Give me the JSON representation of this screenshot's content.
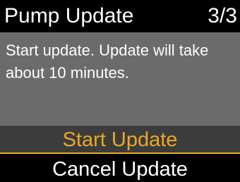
{
  "header": {
    "title": "Pump Update",
    "step": "3/3"
  },
  "body": {
    "message": "Start update. Update will take about 10 minutes."
  },
  "options": {
    "start_label": "Start Update",
    "cancel_label": "Cancel Update",
    "selected": "Start Update"
  },
  "colors": {
    "header_bg": "#000000",
    "body_bg": "#6b6b6b",
    "selected_bg": "#3c3c3c",
    "selected_text": "#e8aa25",
    "normal_text": "#ffffff"
  }
}
